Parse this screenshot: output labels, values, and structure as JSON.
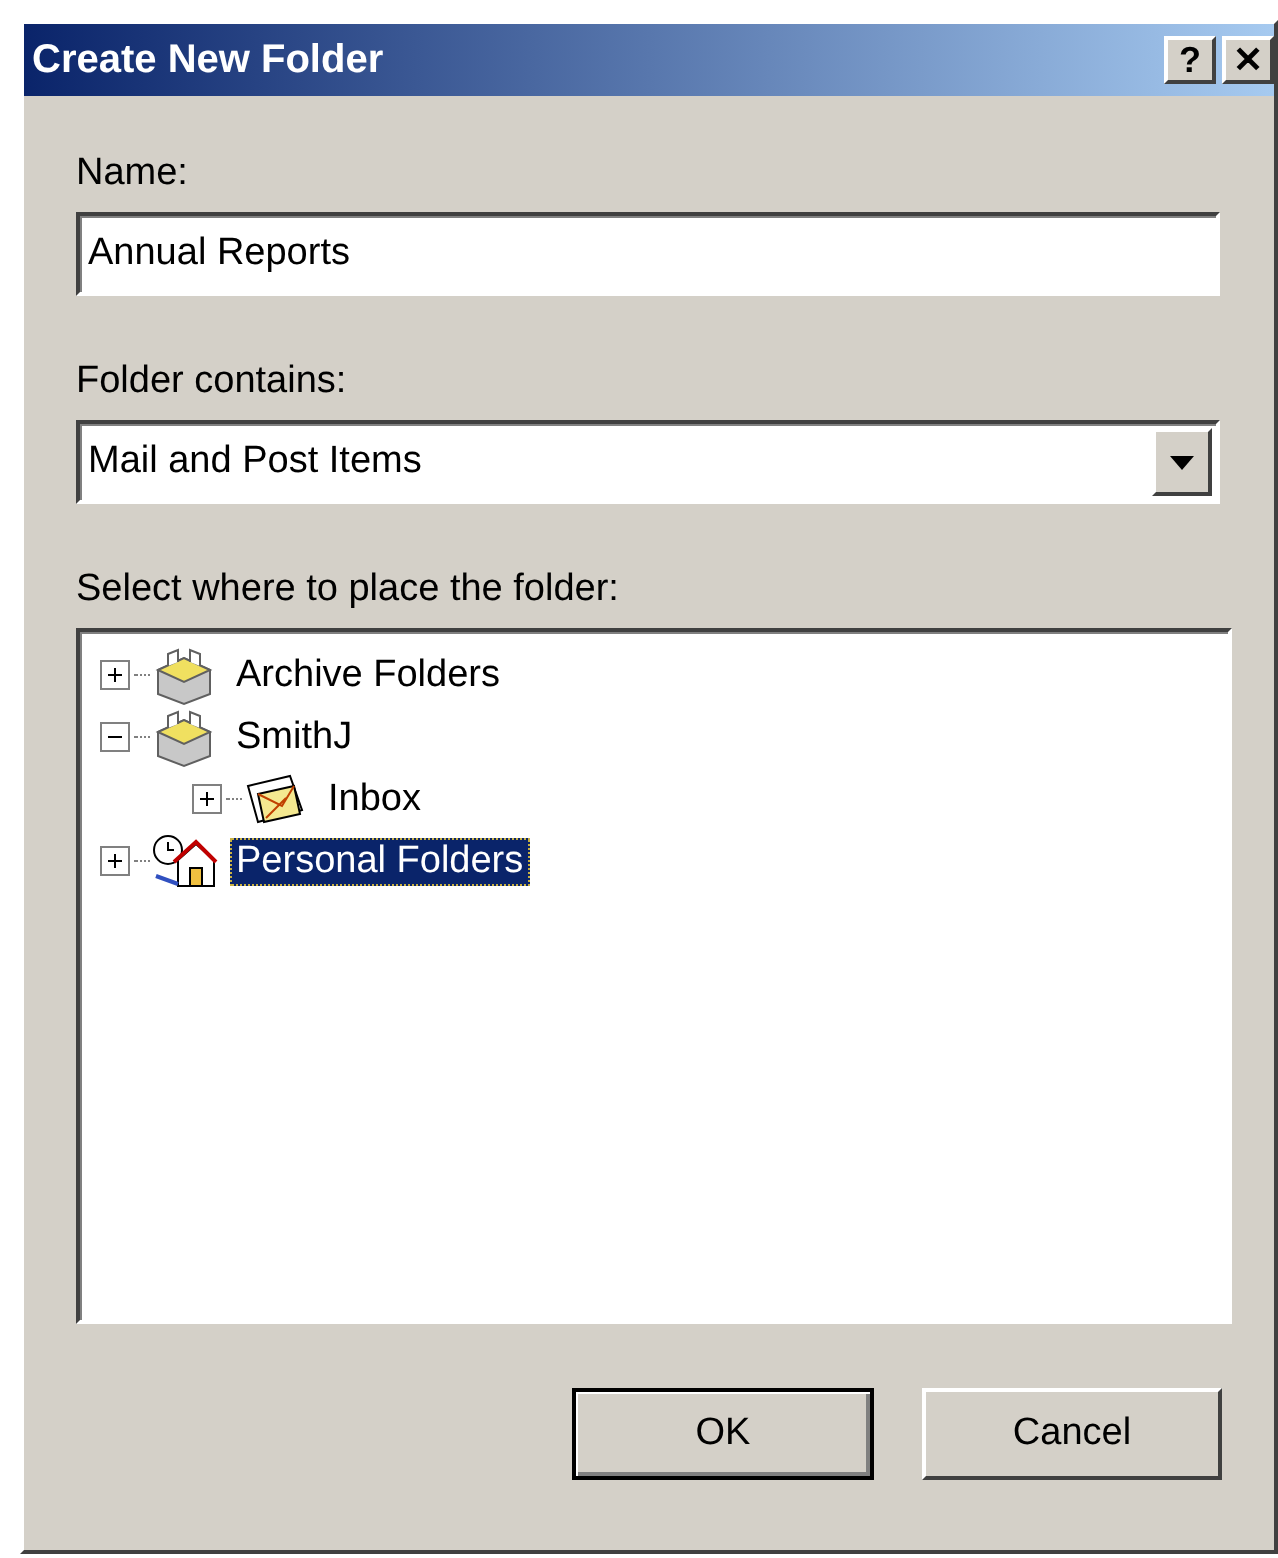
{
  "window": {
    "title": "Create New Folder",
    "title_buttons": [
      "?",
      "✕"
    ]
  },
  "name": {
    "label": "Name:",
    "value": "Annual Reports"
  },
  "folder_contains": {
    "label": "Folder contains:",
    "value": "Mail and Post Items"
  },
  "tree": {
    "label": "Select where to place the folder:",
    "items": [
      {
        "label": "Archive Folders",
        "kind": "mailbox",
        "expanded": false,
        "selected": false
      },
      {
        "label": "SmithJ",
        "kind": "mailbox",
        "expanded": true,
        "selected": false,
        "children": [
          {
            "label": "Inbox",
            "kind": "inbox",
            "expanded": false,
            "selected": false
          }
        ]
      },
      {
        "label": "Personal Folders",
        "kind": "home",
        "expanded": false,
        "selected": true
      }
    ]
  },
  "buttons": [
    {
      "label": "OK",
      "default": true
    },
    {
      "label": "Cancel",
      "default": false
    }
  ]
}
